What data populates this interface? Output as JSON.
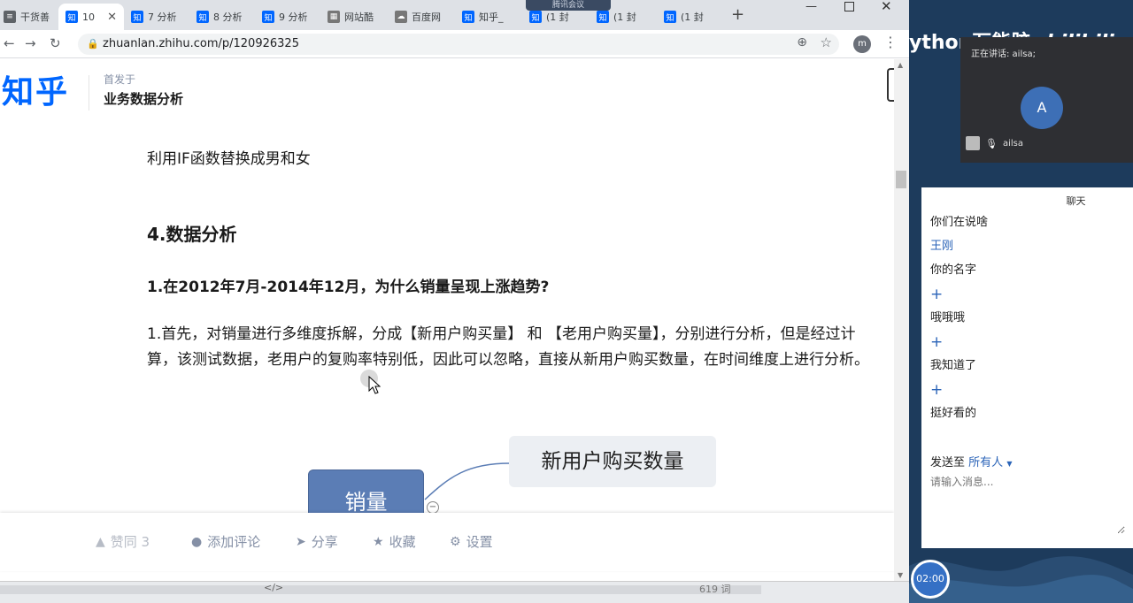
{
  "browser": {
    "tabs": [
      {
        "label": "干货善",
        "icon": "doc-icon"
      },
      {
        "label": "10",
        "icon": "zhihu-icon",
        "active": true
      },
      {
        "label": "7 分析",
        "icon": "zhihu-icon"
      },
      {
        "label": "8 分析",
        "icon": "zhihu-icon"
      },
      {
        "label": "9 分析",
        "icon": "zhihu-icon"
      },
      {
        "label": "网站酷",
        "icon": "chart-icon"
      },
      {
        "label": "百度网",
        "icon": "baidu-icon"
      },
      {
        "label": "知乎_",
        "icon": "zhihu-icon"
      },
      {
        "label": "(1 封",
        "icon": "zhihu-icon"
      },
      {
        "label": "(1 封",
        "icon": "zhihu-icon"
      },
      {
        "label": "(1 封",
        "icon": "zhihu-icon"
      }
    ],
    "meeting_overlay": "腾讯会议",
    "url": "zhuanlan.zhihu.com/p/120926325",
    "profile_initial": "m",
    "statusbar_code": "</>",
    "statusbar_count": "619 词"
  },
  "page": {
    "logo": "知乎",
    "published_label": "首发于",
    "publication": "业务数据分析",
    "paragraph_if": "利用IF函数替换成男和女",
    "heading_analysis": "4.数据分析",
    "heading_q1": "1.在2012年7月-2014年12月，为什么销量呈现上涨趋势?",
    "paragraph_1": "1.首先，对销量进行多维度拆解，分成【新用户购买量】 和 【老用户购买量】，分别进行分析，但是经过计算，该测试数据，老用户的复购率特别低，因此可以忽略，直接从新用户购买数量，在时间维度上进行分析。",
    "mindmap": {
      "root": "销量",
      "child": "新用户购买数量"
    },
    "actions": {
      "like": "赞同 3",
      "comment": "添加评论",
      "share": "分享",
      "favorite": "收藏",
      "settings": "设置"
    }
  },
  "meeting": {
    "brand": "ython万能胶",
    "bilibili": "bilibili",
    "speaking": "正在讲话: ailsa;",
    "avatar_initial": "A",
    "user": "ailsa",
    "chat_title": "聊天",
    "messages": [
      {
        "text": "你们在说啥",
        "type": "text"
      },
      {
        "text": "王刚",
        "type": "name"
      },
      {
        "text": "你的名字",
        "type": "text"
      },
      {
        "text": "+",
        "type": "plus"
      },
      {
        "text": "哦哦哦",
        "type": "text"
      },
      {
        "text": "+",
        "type": "plus"
      },
      {
        "text": "我知道了",
        "type": "text"
      },
      {
        "text": "+",
        "type": "plus"
      },
      {
        "text": "挺好看的",
        "type": "text"
      }
    ],
    "send_to_label": "发送至",
    "send_to_target": "所有人",
    "input_placeholder": "请输入消息...",
    "timer": "02:00"
  },
  "colors": {
    "zhihu_blue": "#0066ff",
    "chat_blue": "#2b64b8",
    "panel_bg": "#1d3b5c",
    "mind_root": "#5b7db5"
  }
}
